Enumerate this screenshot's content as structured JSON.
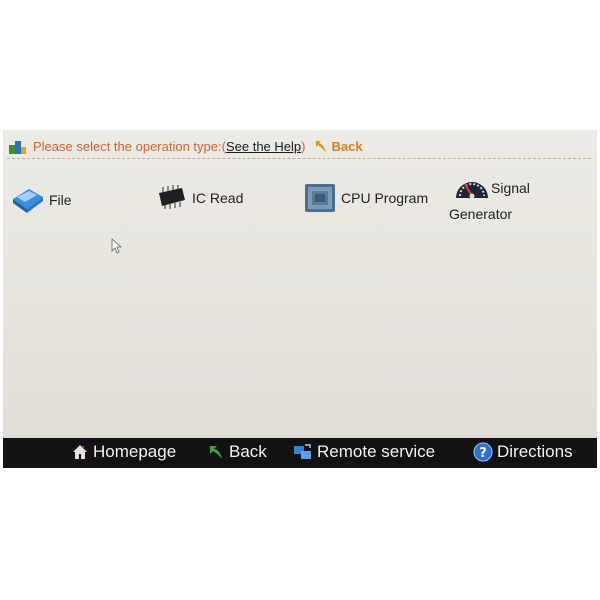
{
  "header": {
    "prompt": "Please select the operation type:",
    "paren_open": "(",
    "help_link": "See the Help",
    "paren_close": ")",
    "back_label": "Back"
  },
  "operations": [
    {
      "label": "File",
      "icon": "file-icon"
    },
    {
      "label": "IC Read",
      "icon": "chip-icon"
    },
    {
      "label": "CPU Program",
      "icon": "cpu-icon"
    },
    {
      "label_line1": "Signal",
      "label_line2": "Generator",
      "icon": "gauge-icon"
    }
  ],
  "taskbar": {
    "homepage": "Homepage",
    "back": "Back",
    "remote_service": "Remote service",
    "directions": "Directions"
  },
  "colors": {
    "prompt": "#d4632e",
    "back_link": "#e07a1f",
    "taskbar_bg": "#121212",
    "display_bg": "#e6e4dd"
  }
}
